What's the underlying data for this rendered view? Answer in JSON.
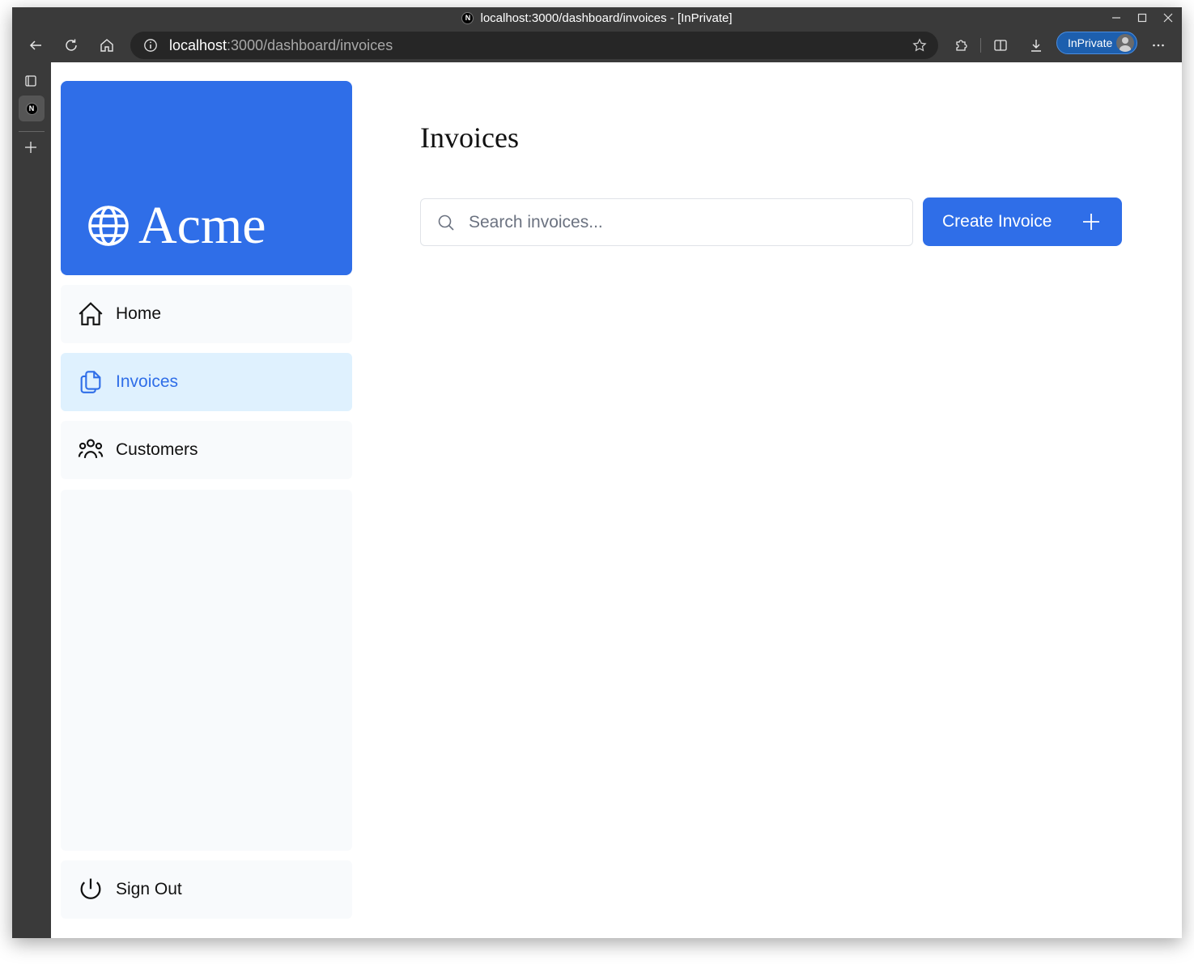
{
  "browser": {
    "window_title": "localhost:3000/dashboard/invoices - [InPrivate]",
    "url_host": "localhost",
    "url_rest": ":3000/dashboard/invoices",
    "inprivate_label": "InPrivate",
    "tab_favicon_letter": "N"
  },
  "sidebar": {
    "brand": "Acme",
    "items": [
      {
        "label": "Home",
        "icon": "home-icon"
      },
      {
        "label": "Invoices",
        "icon": "document-duplicate-icon",
        "active": true
      },
      {
        "label": "Customers",
        "icon": "users-icon"
      }
    ],
    "sign_out_label": "Sign Out"
  },
  "main": {
    "title": "Invoices",
    "search": {
      "placeholder": "Search invoices...",
      "value": ""
    },
    "create_button_label": "Create Invoice"
  },
  "colors": {
    "accent": "#2f6ee8",
    "active_nav_bg": "#dff1fe",
    "nav_bg": "#f8fafc",
    "browser_chrome": "#3a3a3a"
  }
}
